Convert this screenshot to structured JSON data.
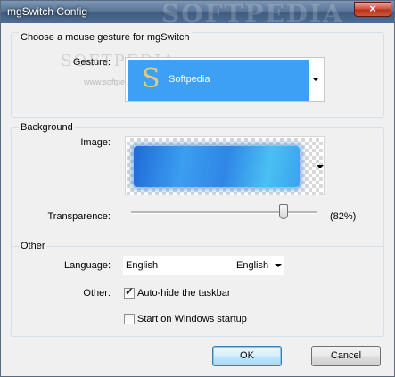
{
  "window": {
    "title": "mgSwitch Config",
    "watermark": "SOFTPEDIA",
    "close_glyph": "×"
  },
  "gesture_group": {
    "header": "Choose a mouse gesture for mgSwitch",
    "gesture_label": "Gesture:",
    "selected_gesture": "Softpedia",
    "gesture_glyph": "S",
    "overlay_watermark": "SOFTPEDIA",
    "overlay_url": "www.softpedia.com"
  },
  "background_group": {
    "header": "Background",
    "image_label": "Image:",
    "transparence_label": "Transparence:",
    "transparence_value": 0.82,
    "transparence_text": "(82%)"
  },
  "other_group": {
    "header": "Other",
    "language_label": "Language:",
    "language_value": "English",
    "language_selected": "English",
    "other_label": "Other:",
    "autohide_label": "Auto-hide the taskbar",
    "autohide_checked": true,
    "startup_label": "Start on Windows startup",
    "startup_checked": false,
    "check_glyph": "✓"
  },
  "buttons": {
    "ok": "OK",
    "cancel": "Cancel"
  },
  "colors": {
    "gesture_bg": "#3da0f4",
    "window_bg": "#f0f0f0",
    "close_red": "#c9573b"
  }
}
